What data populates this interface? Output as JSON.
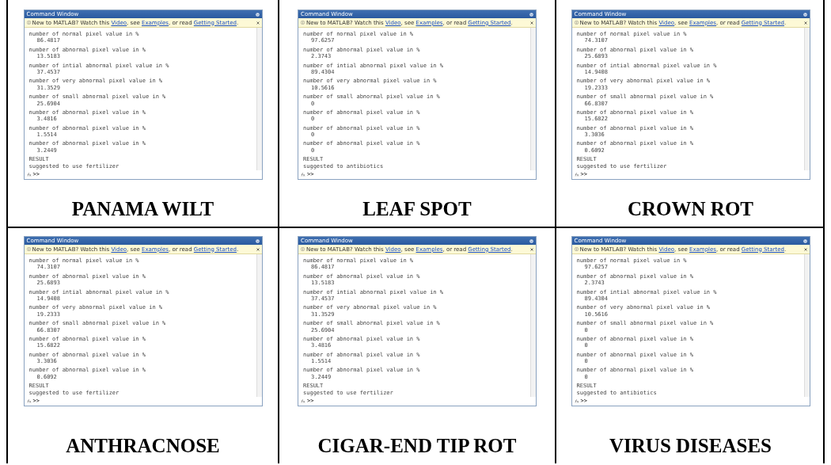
{
  "panels": [
    {
      "caption": "PANAMA WILT",
      "window": {
        "title": "Command Window",
        "banner": [
          {
            "kind": "text",
            "text": "New to MATLAB? Watch this "
          },
          {
            "kind": "link",
            "text": "Video"
          },
          {
            "kind": "text",
            "text": ", see "
          },
          {
            "kind": "link",
            "text": "Examples"
          },
          {
            "kind": "text",
            "text": ", or read "
          },
          {
            "kind": "link",
            "text": "Getting Started"
          },
          {
            "kind": "text",
            "text": "."
          }
        ],
        "entries": [
          {
            "label": "number of normal pixel value in %",
            "value": "86.4817"
          },
          {
            "label": "number of abnormal pixel value in %",
            "value": "13.5183"
          },
          {
            "label": "number of intial abnormal pixel value in %",
            "value": "37.4537"
          },
          {
            "label": "number of very abnormal pixel value in %",
            "value": "31.3529"
          },
          {
            "label": "number of small abnormal pixel value in %",
            "value": "25.6904"
          },
          {
            "label": "number of abnormal pixel value in %",
            "value": "3.4816"
          },
          {
            "label": "number of abnormal pixel value in %",
            "value": "1.5514"
          },
          {
            "label": "number of abnormal pixel value in %",
            "value": "3.2449"
          }
        ],
        "result_label": "RESULT",
        "result_text": "suggested to use fertilizer",
        "prompt": ">>"
      }
    },
    {
      "caption": "LEAF SPOT",
      "window": {
        "title": "Command Window",
        "banner": [
          {
            "kind": "text",
            "text": "New to MATLAB? Watch this "
          },
          {
            "kind": "link",
            "text": "Video"
          },
          {
            "kind": "text",
            "text": ", see "
          },
          {
            "kind": "link",
            "text": "Examples"
          },
          {
            "kind": "text",
            "text": ", or read "
          },
          {
            "kind": "link",
            "text": "Getting Started"
          },
          {
            "kind": "text",
            "text": "."
          }
        ],
        "entries": [
          {
            "label": "number of normal pixel value in %",
            "value": "97.6257"
          },
          {
            "label": "number of abnormal pixel value in %",
            "value": "2.3743"
          },
          {
            "label": "number of intial abnormal pixel value in %",
            "value": "89.4304"
          },
          {
            "label": "number of very abnormal pixel value in %",
            "value": "10.5616"
          },
          {
            "label": "number of small abnormal pixel value in %",
            "value": "0"
          },
          {
            "label": "number of abnormal pixel value in %",
            "value": "0"
          },
          {
            "label": "number of abnormal pixel value in %",
            "value": "0"
          },
          {
            "label": "number of abnormal pixel value in %",
            "value": "0"
          }
        ],
        "result_label": "RESULT",
        "result_text": "suggested to antibiotics",
        "prompt": ">>"
      }
    },
    {
      "caption": "CROWN ROT",
      "window": {
        "title": "Command Window",
        "banner": [
          {
            "kind": "text",
            "text": "New to MATLAB? Watch this "
          },
          {
            "kind": "link",
            "text": "Video"
          },
          {
            "kind": "text",
            "text": ", see "
          },
          {
            "kind": "link",
            "text": "Examples"
          },
          {
            "kind": "text",
            "text": ", or read "
          },
          {
            "kind": "link",
            "text": "Getting Started"
          },
          {
            "kind": "text",
            "text": "."
          }
        ],
        "entries": [
          {
            "label": "number of normal pixel value in %",
            "value": "74.3107"
          },
          {
            "label": "number of abnormal pixel value in %",
            "value": "25.6893"
          },
          {
            "label": "number of intial abnormal pixel value in %",
            "value": "14.9408"
          },
          {
            "label": "number of very abnormal pixel value in %",
            "value": "19.2333"
          },
          {
            "label": "number of small abnormal pixel value in %",
            "value": "66.8307"
          },
          {
            "label": "number of abnormal pixel value in %",
            "value": "15.6822"
          },
          {
            "label": "number of abnormal pixel value in %",
            "value": "3.3036"
          },
          {
            "label": "number of abnormal pixel value in %",
            "value": "0.6092"
          }
        ],
        "result_label": "RESULT",
        "result_text": "suggested to use fertilizer",
        "prompt": ">>"
      }
    },
    {
      "caption": "ANTHRACNOSE",
      "window": {
        "title": "Command Window",
        "banner": [
          {
            "kind": "text",
            "text": "New to MATLAB? Watch this "
          },
          {
            "kind": "link",
            "text": "Video"
          },
          {
            "kind": "text",
            "text": ", see "
          },
          {
            "kind": "link",
            "text": "Examples"
          },
          {
            "kind": "text",
            "text": ", or read "
          },
          {
            "kind": "link",
            "text": "Getting Started"
          },
          {
            "kind": "text",
            "text": "."
          }
        ],
        "entries": [
          {
            "label": "number of normal pixel value in %",
            "value": "74.3107"
          },
          {
            "label": "number of abnormal pixel value in %",
            "value": "25.6893"
          },
          {
            "label": "number of intial abnormal pixel value in %",
            "value": "14.9408"
          },
          {
            "label": "number of very abnormal pixel value in %",
            "value": "19.2333"
          },
          {
            "label": "number of small abnormal pixel value in %",
            "value": "66.8307"
          },
          {
            "label": "number of abnormal pixel value in %",
            "value": "15.6822"
          },
          {
            "label": "number of abnormal pixel value in %",
            "value": "3.3036"
          },
          {
            "label": "number of abnormal pixel value in %",
            "value": "0.6092"
          }
        ],
        "result_label": "RESULT",
        "result_text": "suggested to use fertilizer",
        "prompt": ">>"
      }
    },
    {
      "caption": "CIGAR-END TIP ROT",
      "window": {
        "title": "Command Window",
        "banner": [
          {
            "kind": "text",
            "text": "New to MATLAB? Watch this "
          },
          {
            "kind": "link",
            "text": "Video"
          },
          {
            "kind": "text",
            "text": ", see "
          },
          {
            "kind": "link",
            "text": "Examples"
          },
          {
            "kind": "text",
            "text": ", or read "
          },
          {
            "kind": "link",
            "text": "Getting Started"
          },
          {
            "kind": "text",
            "text": "."
          }
        ],
        "entries": [
          {
            "label": "number of normal pixel value in %",
            "value": "86.4817"
          },
          {
            "label": "number of abnormal pixel value in %",
            "value": "13.5183"
          },
          {
            "label": "number of intial abnormal pixel value in %",
            "value": "37.4537"
          },
          {
            "label": "number of very abnormal pixel value in %",
            "value": "31.3529"
          },
          {
            "label": "number of small abnormal pixel value in %",
            "value": "25.6904"
          },
          {
            "label": "number of abnormal pixel value in %",
            "value": "3.4816"
          },
          {
            "label": "number of abnormal pixel value in %",
            "value": "1.5514"
          },
          {
            "label": "number of abnormal pixel value in %",
            "value": "3.2449"
          }
        ],
        "result_label": "RESULT",
        "result_text": "suggested to use fertilizer",
        "prompt": ">>"
      }
    },
    {
      "caption": "VIRUS DISEASES",
      "window": {
        "title": "Command Window",
        "banner": [
          {
            "kind": "text",
            "text": "New to MATLAB? Watch this "
          },
          {
            "kind": "link",
            "text": "Video"
          },
          {
            "kind": "text",
            "text": ", see "
          },
          {
            "kind": "link",
            "text": "Examples"
          },
          {
            "kind": "text",
            "text": ", or read "
          },
          {
            "kind": "link",
            "text": "Getting Started"
          },
          {
            "kind": "text",
            "text": "."
          }
        ],
        "entries": [
          {
            "label": "number of normal pixel value in %",
            "value": "97.6257"
          },
          {
            "label": "number of abnormal pixel value in %",
            "value": "2.3743"
          },
          {
            "label": "number of intial abnormal pixel value in %",
            "value": "89.4304"
          },
          {
            "label": "number of very abnormal pixel value in %",
            "value": "10.5616"
          },
          {
            "label": "number of small abnormal pixel value in %",
            "value": "0"
          },
          {
            "label": "number of abnormal pixel value in %",
            "value": "0"
          },
          {
            "label": "number of abnormal pixel value in %",
            "value": "0"
          },
          {
            "label": "number of abnormal pixel value in %",
            "value": "0"
          }
        ],
        "result_label": "RESULT",
        "result_text": "suggested to antibiotics",
        "prompt": ">>"
      }
    }
  ]
}
